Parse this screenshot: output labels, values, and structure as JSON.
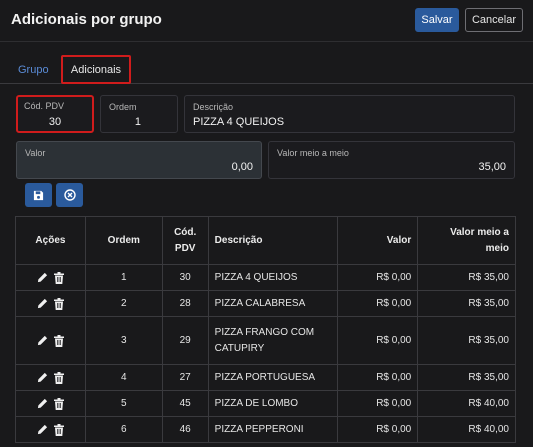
{
  "header": {
    "title": "Adicionais por grupo",
    "save_label": "Salvar",
    "cancel_label": "Cancelar"
  },
  "tabs": [
    {
      "label": "Grupo"
    },
    {
      "label": "Adicionais"
    }
  ],
  "form": {
    "cod_pdv": {
      "label": "Cód. PDV",
      "value": "30"
    },
    "ordem": {
      "label": "Ordem",
      "value": "1"
    },
    "descricao": {
      "label": "Descrição",
      "value": "PIZZA 4 QUEIJOS"
    },
    "valor": {
      "label": "Valor",
      "value": "0,00"
    },
    "valor_meio": {
      "label": "Valor meio a meio",
      "value": "35,00"
    }
  },
  "actions": {
    "save_icon": "floppy-disk-icon",
    "cancel_icon": "circle-x-icon"
  },
  "colors": {
    "accent": "#2a5a9c",
    "link": "#5a8bd6",
    "highlight": "#d01c1c"
  },
  "table": {
    "headers": {
      "acoes": "Ações",
      "ordem": "Ordem",
      "cod_pdv": "Cód. PDV",
      "descricao": "Descrição",
      "valor": "Valor",
      "valor_meio": "Valor meio a meio"
    },
    "rows": [
      {
        "ordem": "1",
        "cod": "30",
        "desc": "PIZZA 4 QUEIJOS",
        "valor": "R$ 0,00",
        "meio": "R$ 35,00"
      },
      {
        "ordem": "2",
        "cod": "28",
        "desc": "PIZZA CALABRESA",
        "valor": "R$ 0,00",
        "meio": "R$ 35,00"
      },
      {
        "ordem": "3",
        "cod": "29",
        "desc": "PIZZA FRANGO COM CATUPIRY",
        "valor": "R$ 0,00",
        "meio": "R$ 35,00"
      },
      {
        "ordem": "4",
        "cod": "27",
        "desc": "PIZZA PORTUGUESA",
        "valor": "R$ 0,00",
        "meio": "R$ 35,00"
      },
      {
        "ordem": "5",
        "cod": "45",
        "desc": "PIZZA DE LOMBO",
        "valor": "R$ 0,00",
        "meio": "R$ 40,00"
      },
      {
        "ordem": "6",
        "cod": "46",
        "desc": "PIZZA PEPPERONI",
        "valor": "R$ 0,00",
        "meio": "R$ 40,00"
      }
    ]
  }
}
